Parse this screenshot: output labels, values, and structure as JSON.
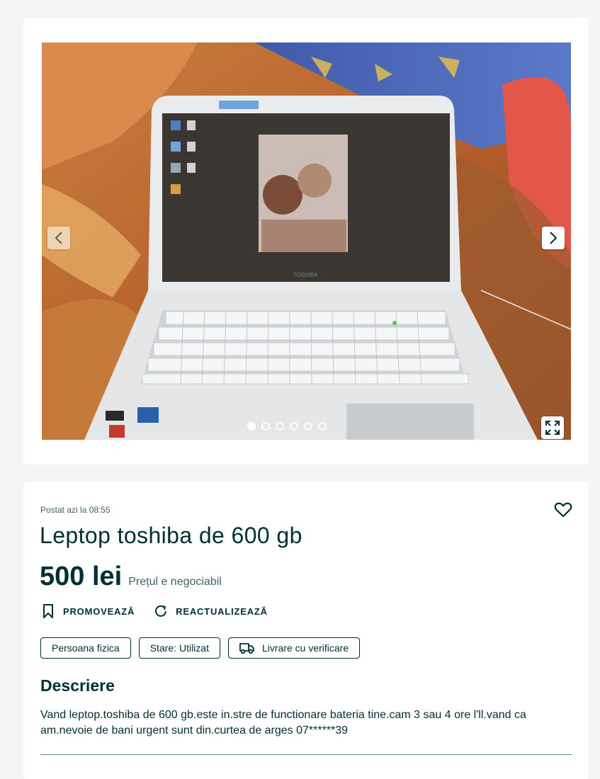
{
  "gallery": {
    "photo_alt": "Toshiba laptop on a bed",
    "laptop_brand": "TOSHIBA",
    "dots_total": 6,
    "active_dot": 0
  },
  "ad": {
    "posted": "Postat azi la 08:55",
    "title": "Leptop toshiba de 600 gb",
    "price": "500 lei",
    "price_note": "Prețul e negociabil"
  },
  "actions": {
    "promote": "PROMOVEAZĂ",
    "refresh": "REACTUALIZEAZĂ"
  },
  "tags": {
    "seller_type": "Persoana fizica",
    "condition": "Stare: Utilizat",
    "delivery": "Livrare cu verificare"
  },
  "description": {
    "heading": "Descriere",
    "text": "Vand leptop.toshiba de 600 gb.este in.stre de functionare bateria tine.cam 3 sau 4 ore l'll.vand ca am.nevoie de bani urgent sunt din.curtea de arges 07******39"
  },
  "colors": {
    "text": "#002f34",
    "background": "#f2f4f5",
    "card": "#ffffff"
  }
}
